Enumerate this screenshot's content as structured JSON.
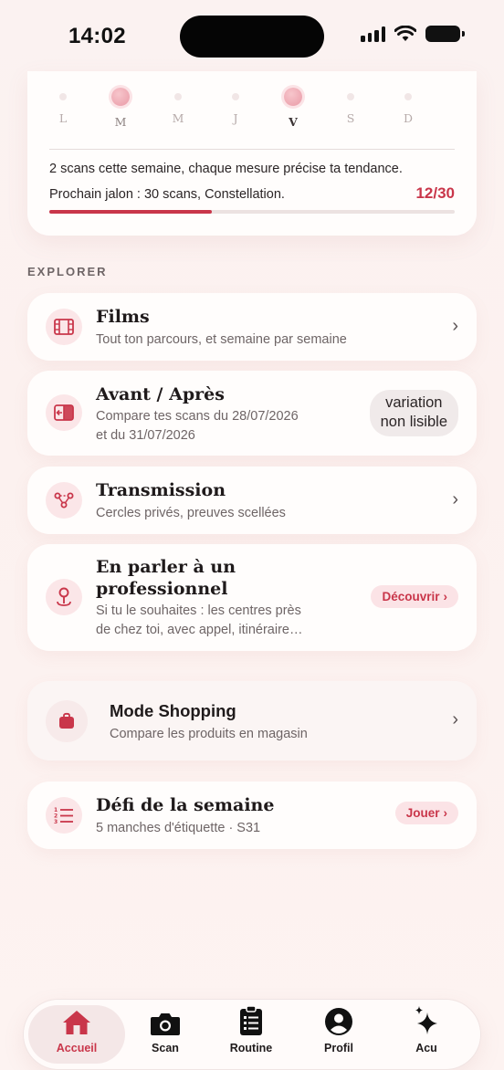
{
  "status_bar": {
    "time": "14:02"
  },
  "weekly": {
    "days": [
      {
        "label": "L",
        "scanned": false,
        "today": false
      },
      {
        "label": "M",
        "scanned": true,
        "today": false
      },
      {
        "label": "M",
        "scanned": false,
        "today": false
      },
      {
        "label": "J",
        "scanned": false,
        "today": false
      },
      {
        "label": "V",
        "scanned": true,
        "today": true
      },
      {
        "label": "S",
        "scanned": false,
        "today": false
      },
      {
        "label": "D",
        "scanned": false,
        "today": false
      }
    ],
    "scans_text": "2 scans cette semaine, chaque mesure précise ta tendance.",
    "milestone_text": "Prochain jalon : 30 scans, Constellation.",
    "milestone_count": "12/30",
    "progress_fraction": 0.4
  },
  "explore": {
    "section_label": "EXPLORER",
    "films": {
      "title": "Films",
      "subtitle": "Tout ton parcours, et semaine par semaine",
      "icon": "film-icon"
    },
    "before_after": {
      "title": "Avant / Après",
      "subtitle_line1": "Compare tes scans du 28/07/2026",
      "subtitle_line2": "et du 31/07/2026",
      "badge_line1": "variation",
      "badge_line2": "non lisible",
      "icon": "compare-icon"
    },
    "transmission": {
      "title": "Transmission",
      "subtitle": "Cercles privés, preuves scellées",
      "icon": "share-nodes-icon"
    },
    "professional": {
      "title_line1": "En parler à un",
      "title_line2": "professionnel",
      "subtitle_line1": "Si tu le souhaites : les centres près",
      "subtitle_line2": "de chez toi, avec appel, itinéraire…",
      "action": "Découvrir",
      "icon": "map-pin-icon"
    },
    "shopping": {
      "title": "Mode Shopping",
      "subtitle": "Compare les produits en magasin",
      "icon": "shopping-bag-icon"
    },
    "challenge": {
      "title": "Défi de la semaine",
      "subtitle": "5 manches d'étiquette · S31",
      "action": "Jouer",
      "icon": "numbered-list-icon"
    }
  },
  "tabs": [
    {
      "label": "Accueil",
      "icon": "home-icon",
      "active": true
    },
    {
      "label": "Scan",
      "icon": "camera-icon",
      "active": false
    },
    {
      "label": "Routine",
      "icon": "clipboard-icon",
      "active": false
    },
    {
      "label": "Profil",
      "icon": "profile-icon",
      "active": false
    },
    {
      "label": "Acu",
      "icon": "sparkles-icon",
      "active": false
    }
  ],
  "colors": {
    "accent": "#c9364a",
    "accent_soft": "#fbe3e6",
    "background": "#fbf2f1",
    "card": "#fffdfc"
  }
}
